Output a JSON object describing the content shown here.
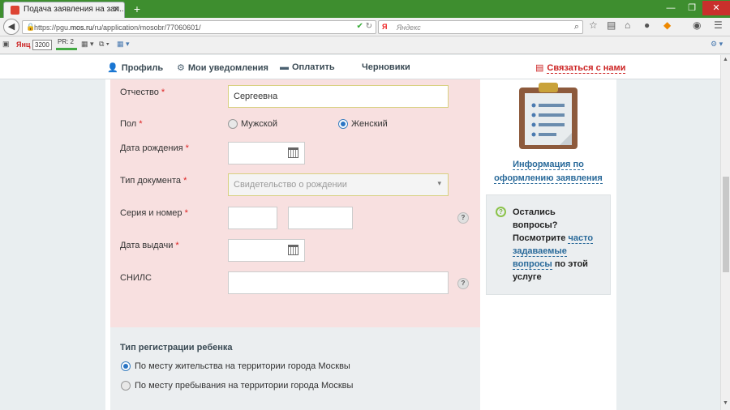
{
  "browser": {
    "tab_title": "Подача заявления на зап...",
    "url_prefix": "https://pgu.",
    "url_host": "mos.ru",
    "url_path": "/ru/application/mosobr/77060601/",
    "search_engine": "Я",
    "search_placeholder": "Яндекс",
    "bookmark_label": "Янц",
    "bookmark_value": "3200",
    "pr_label": "PR: 2"
  },
  "nav": {
    "profile": "Профиль",
    "notifications": "Мои уведомления",
    "pay": "Оплатить",
    "drafts": "Черновики",
    "contact": "Связаться с нами"
  },
  "form": {
    "required_mark": "*",
    "patronymic_label": "Отчество",
    "patronymic_value": "Сергеевна",
    "gender_label": "Пол",
    "gender_male": "Мужской",
    "gender_female": "Женский",
    "gender_selected": "female",
    "birthdate_label": "Дата рождения",
    "doctype_label": "Тип документа",
    "doctype_placeholder": "Свидетельство о рождении",
    "series_label": "Серия и номер",
    "issue_date_label": "Дата выдачи",
    "snils_label": "СНИЛС",
    "help_glyph": "?"
  },
  "registration": {
    "title": "Тип регистрации ребенка",
    "option_residence": "По месту жительства на территории города Москвы",
    "option_stay": "По месту пребывания на территории города Москвы",
    "selected": "residence"
  },
  "sidebar": {
    "info_line1": "Информация по",
    "info_line2": "оформлению заявления",
    "faq_q_glyph": "?",
    "faq_line1": "Остались",
    "faq_line2": "вопросы?",
    "faq_line3_prefix": "Посмотрите ",
    "faq_link1": "часто",
    "faq_link2": "задаваемые",
    "faq_link3": "вопросы",
    "faq_line5_suffix": " по этой",
    "faq_line6": "услуге"
  },
  "colors": {
    "titlebar": "#3e8e2f",
    "form_bg": "#f8e0e0",
    "link": "#2a6a9a",
    "required": "#dd2222",
    "contact": "#cc2222"
  }
}
